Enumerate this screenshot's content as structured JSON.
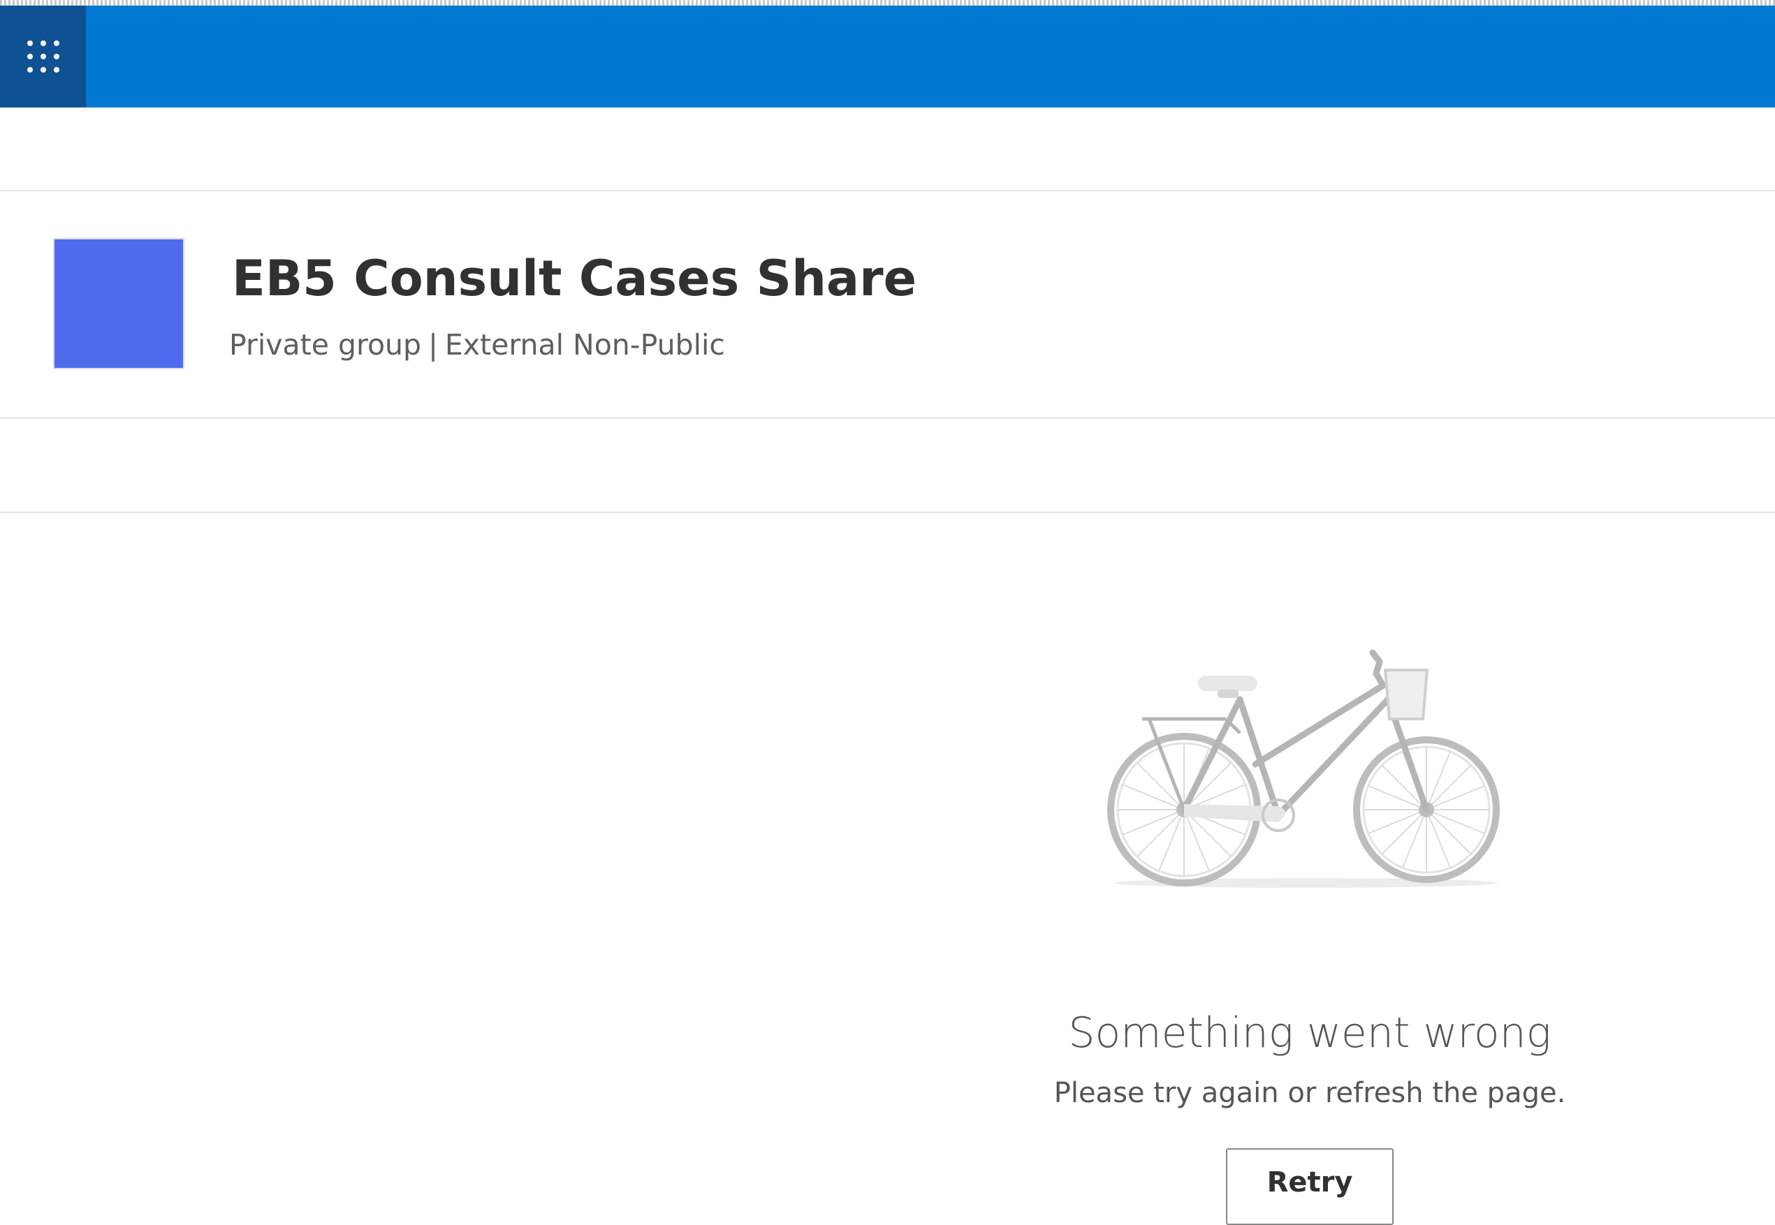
{
  "suite_bar": {
    "color": "#0078d4",
    "app_launcher_color": "#0f5293",
    "app_launcher_icon": "waffle-icon"
  },
  "site": {
    "title": "EB5 Consult Cases Share",
    "privacy": "Private group",
    "separator": "|",
    "classification": "External Non-Public",
    "logo_color": "#4f6bed"
  },
  "error": {
    "illustration": "bicycle-icon",
    "title": "Something went wrong",
    "message": "Please try again or refresh the page.",
    "retry_label": "Retry"
  }
}
